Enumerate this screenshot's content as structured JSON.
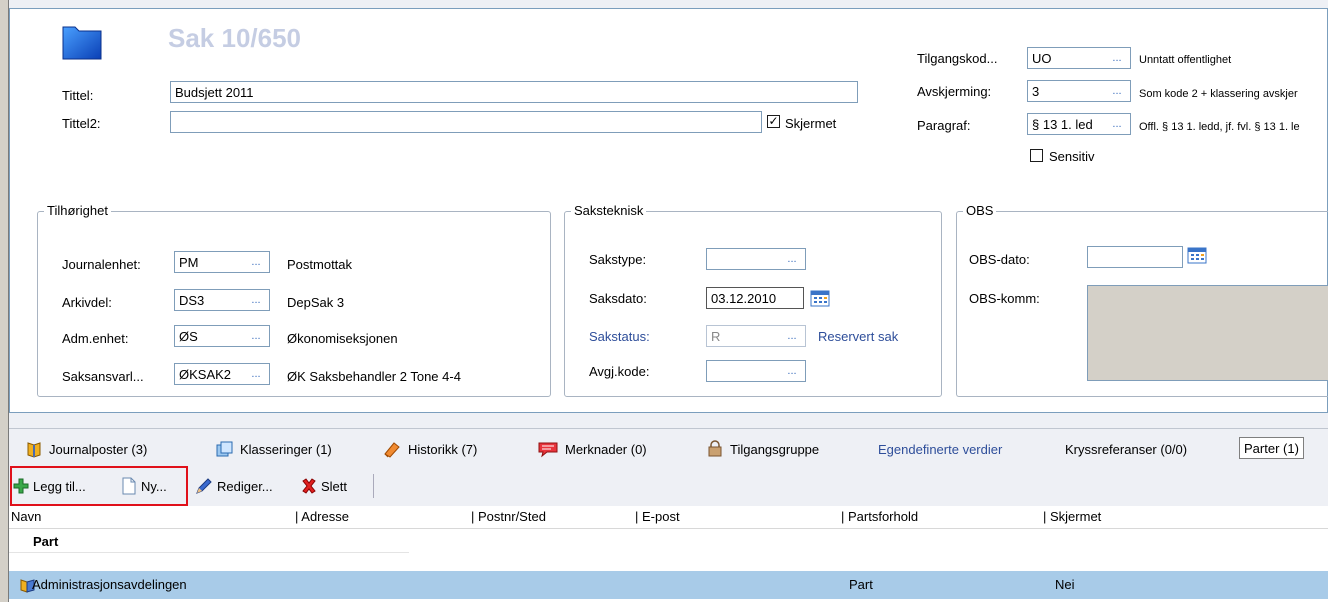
{
  "header": {
    "title": "Sak 10/650"
  },
  "fields": {
    "tittel": {
      "label": "Tittel:",
      "value": "Budsjett 2011"
    },
    "tittel2": {
      "label": "Tittel2:",
      "value": ""
    },
    "skjermet": {
      "label": "Skjermet",
      "checked": true
    }
  },
  "access": {
    "tilgangskode": {
      "label": "Tilgangskod...",
      "value": "UO",
      "desc": "Unntatt offentlighet"
    },
    "avskjerming": {
      "label": "Avskjerming:",
      "value": "3",
      "desc": "Som kode 2 + klassering avskjer"
    },
    "paragraf": {
      "label": "Paragraf:",
      "value": "§ 13 1. led",
      "desc": "Offl. § 13 1. ledd, jf. fvl. § 13 1. le"
    },
    "sensitiv": {
      "label": "Sensitiv",
      "checked": false
    }
  },
  "tilhorighet": {
    "legend": "Tilhørighet",
    "rows": [
      {
        "label": "Journalenhet:",
        "value": "PM",
        "desc": "Postmottak"
      },
      {
        "label": "Arkivdel:",
        "value": "DS3",
        "desc": "DepSak 3"
      },
      {
        "label": "Adm.enhet:",
        "value": "ØS",
        "desc": "Økonomiseksjonen"
      },
      {
        "label": "Saksansvarl...",
        "value": "ØKSAK2",
        "desc": "ØK Saksbehandler 2  Tone 4-4"
      }
    ]
  },
  "saksteknisk": {
    "legend": "Saksteknisk",
    "sakstype": {
      "label": "Sakstype:",
      "value": ""
    },
    "saksdato": {
      "label": "Saksdato:",
      "value": "03.12.2010"
    },
    "sakstatus": {
      "label": "Sakstatus:",
      "value": "R",
      "desc": "Reservert sak"
    },
    "avgjkode": {
      "label": "Avgj.kode:",
      "value": ""
    }
  },
  "obs": {
    "legend": "OBS",
    "obsdato": {
      "label": "OBS-dato:",
      "value": ""
    },
    "obskomm": {
      "label": "OBS-komm:"
    }
  },
  "ellipsis": "...",
  "tabs": [
    {
      "label": "Journalposter (3)",
      "icon": "book-icon"
    },
    {
      "label": "Klasseringer (1)",
      "icon": "pages-icon"
    },
    {
      "label": "Historikk (7)",
      "icon": "eraser-icon"
    },
    {
      "label": "Merknader (0)",
      "icon": "comment-icon"
    },
    {
      "label": "Tilgangsgruppe",
      "icon": "group-icon"
    },
    {
      "label": "Egendefinerte verdier"
    },
    {
      "label": "Kryssreferanser (0/0)"
    },
    {
      "label": "Parter (1)",
      "active": true
    }
  ],
  "toolbar": {
    "add_label": "Legg til...",
    "new_label": "Ny...",
    "edit_label": "Rediger...",
    "delete_label": "Slett"
  },
  "grid": {
    "columns": [
      "Navn",
      "Adresse",
      "Postnr/Sted",
      "E-post",
      "Partsforhold",
      "Skjermet"
    ],
    "group_label": "Part",
    "rows": [
      {
        "navn": "Administrasjonsavdelingen",
        "adresse": "",
        "postnr": "",
        "epost": "",
        "partsforhold": "Part",
        "skjermet": "Nei"
      }
    ]
  },
  "colors": {
    "selected_row": "#a8cbe8",
    "highlight_box": "#e0101a",
    "link_blue": "#2e4e9a"
  }
}
